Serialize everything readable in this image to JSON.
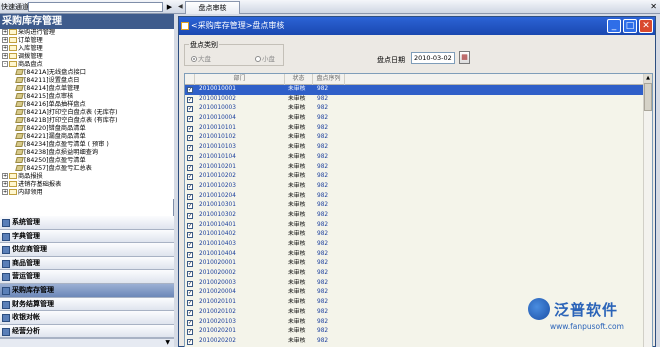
{
  "topbar": {
    "quick_label": "快速通道",
    "quick_value": "",
    "go_arrow": "▶",
    "tab_nav": "◀",
    "tab_title": "盘点审核",
    "close_glyph": "✕"
  },
  "left": {
    "title": "采购库存管理",
    "tree": [
      {
        "level": 0,
        "kind": "folder",
        "exp": "+",
        "label": "采购进行管理"
      },
      {
        "level": 0,
        "kind": "folder",
        "exp": "+",
        "label": "订单管理"
      },
      {
        "level": 0,
        "kind": "folder",
        "exp": "+",
        "label": "入库管理"
      },
      {
        "level": 0,
        "kind": "folder",
        "exp": "+",
        "label": "调拨管理"
      },
      {
        "level": 0,
        "kind": "folder",
        "exp": "-",
        "label": "商品盘点"
      },
      {
        "level": 1,
        "kind": "doc",
        "label": "[8421A]无线盘点接口"
      },
      {
        "level": 1,
        "kind": "doc",
        "label": "[84211]设置盘点日"
      },
      {
        "level": 1,
        "kind": "doc",
        "label": "[84214]盘点单管理"
      },
      {
        "level": 1,
        "kind": "doc",
        "label": "[84215]盘点审核"
      },
      {
        "level": 1,
        "kind": "doc",
        "label": "[84216]单品抽样盘点"
      },
      {
        "level": 1,
        "kind": "doc",
        "label": "[8421A]打印空白盘点表 (无库存)"
      },
      {
        "level": 1,
        "kind": "doc",
        "label": "[8421B]打印空白盘点表 (有库存)"
      },
      {
        "level": 1,
        "kind": "doc",
        "label": "[84220]错盘商品清单"
      },
      {
        "level": 1,
        "kind": "doc",
        "label": "[84221]漏盘商品清单"
      },
      {
        "level": 1,
        "kind": "doc",
        "label": "[84234]盘点盈亏清单 ( 预审 )"
      },
      {
        "level": 1,
        "kind": "doc",
        "label": "[84238]盘点损益明细查询"
      },
      {
        "level": 1,
        "kind": "doc",
        "label": "[84250]盘点盈亏清单"
      },
      {
        "level": 1,
        "kind": "doc",
        "label": "[84257]盘点盈亏汇总表"
      },
      {
        "level": 0,
        "kind": "folder",
        "exp": "+",
        "label": "商品报损"
      },
      {
        "level": 0,
        "kind": "folder",
        "exp": "+",
        "label": "进销存基础报表"
      },
      {
        "level": 0,
        "kind": "folder",
        "exp": "+",
        "label": "内部领用"
      }
    ],
    "splitter": "......",
    "modules": [
      {
        "label": "系统管理",
        "active": false
      },
      {
        "label": "字典管理",
        "active": false
      },
      {
        "label": "供应商管理",
        "active": false
      },
      {
        "label": "商品管理",
        "active": false
      },
      {
        "label": "营运管理",
        "active": false
      },
      {
        "label": "采购库存管理",
        "active": true
      },
      {
        "label": "财务结算管理",
        "active": false
      },
      {
        "label": "收银对帐",
        "active": false
      },
      {
        "label": "经营分析",
        "active": false
      }
    ],
    "bottom_arrow": "▼"
  },
  "window": {
    "title": "<采购库存管理>盘点审核",
    "btn_min": "_",
    "btn_max": "□",
    "btn_close": "✕",
    "filter": {
      "group_label": "盘点类别",
      "options": [
        "大盘",
        "小盘"
      ],
      "selected": "大盘"
    },
    "date_label": "盘点日期",
    "date_value": "2010-03-02",
    "cal_glyph": "▦",
    "grid": {
      "columns": [
        "",
        "部门",
        "状态",
        "盘点序列"
      ],
      "rows": [
        {
          "checked": true,
          "dept": "2010010001",
          "status": "未审核",
          "seq": "982",
          "selected": true
        },
        {
          "checked": true,
          "dept": "2010010002",
          "status": "未审核",
          "seq": "982"
        },
        {
          "checked": true,
          "dept": "2010010003",
          "status": "未审核",
          "seq": "982"
        },
        {
          "checked": true,
          "dept": "2010010004",
          "status": "未审核",
          "seq": "982"
        },
        {
          "checked": true,
          "dept": "2010010101",
          "status": "未审核",
          "seq": "982"
        },
        {
          "checked": true,
          "dept": "2010010102",
          "status": "未审核",
          "seq": "982"
        },
        {
          "checked": true,
          "dept": "2010010103",
          "status": "未审核",
          "seq": "982"
        },
        {
          "checked": true,
          "dept": "2010010104",
          "status": "未审核",
          "seq": "982"
        },
        {
          "checked": true,
          "dept": "2010010201",
          "status": "未审核",
          "seq": "982"
        },
        {
          "checked": true,
          "dept": "2010010202",
          "status": "未审核",
          "seq": "982"
        },
        {
          "checked": true,
          "dept": "2010010203",
          "status": "未审核",
          "seq": "982"
        },
        {
          "checked": true,
          "dept": "2010010204",
          "status": "未审核",
          "seq": "982"
        },
        {
          "checked": true,
          "dept": "2010010301",
          "status": "未审核",
          "seq": "982"
        },
        {
          "checked": true,
          "dept": "2010010302",
          "status": "未审核",
          "seq": "982"
        },
        {
          "checked": true,
          "dept": "2010010401",
          "status": "未审核",
          "seq": "982"
        },
        {
          "checked": true,
          "dept": "2010010402",
          "status": "未审核",
          "seq": "982"
        },
        {
          "checked": true,
          "dept": "2010010403",
          "status": "未审核",
          "seq": "982"
        },
        {
          "checked": true,
          "dept": "2010010404",
          "status": "未审核",
          "seq": "982"
        },
        {
          "checked": true,
          "dept": "2010020001",
          "status": "未审核",
          "seq": "982"
        },
        {
          "checked": true,
          "dept": "2010020002",
          "status": "未审核",
          "seq": "982"
        },
        {
          "checked": true,
          "dept": "2010020003",
          "status": "未审核",
          "seq": "982"
        },
        {
          "checked": true,
          "dept": "2010020004",
          "status": "未审核",
          "seq": "982"
        },
        {
          "checked": true,
          "dept": "2010020101",
          "status": "未审核",
          "seq": "982"
        },
        {
          "checked": true,
          "dept": "2010020102",
          "status": "未审核",
          "seq": "982"
        },
        {
          "checked": true,
          "dept": "2010020103",
          "status": "未审核",
          "seq": "982"
        },
        {
          "checked": true,
          "dept": "2010020201",
          "status": "未审核",
          "seq": "982"
        },
        {
          "checked": true,
          "dept": "2010020202",
          "status": "未审核",
          "seq": "982"
        }
      ]
    }
  },
  "brand": {
    "name": "泛普软件",
    "url": "www.fanpusoft.com"
  },
  "colors": {
    "title_bar": "#1a48b0",
    "selected_row": "#2f5fc8",
    "left_title": "#3e5b8c",
    "brand": "#2a63b8"
  }
}
